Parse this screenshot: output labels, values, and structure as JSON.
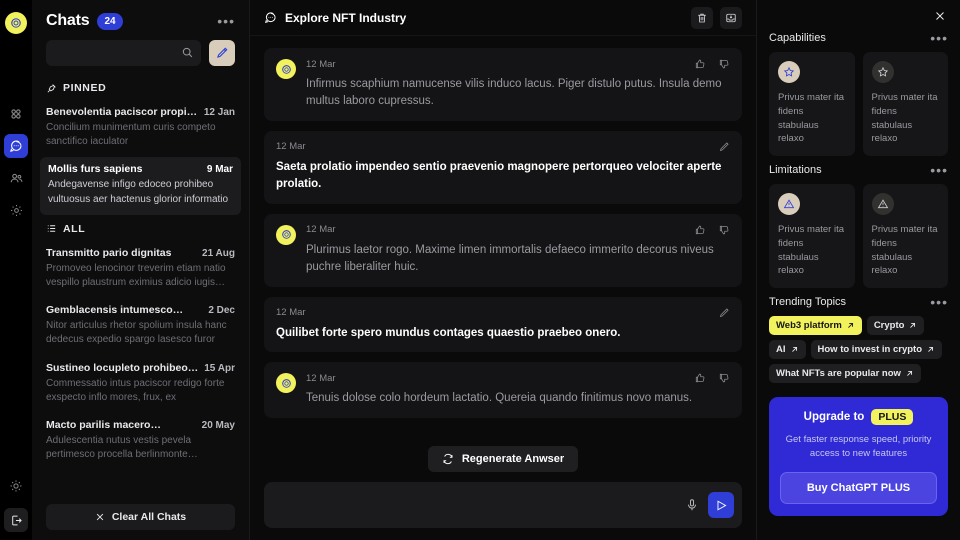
{
  "rail": {
    "logo": "openai-logo",
    "items": [
      {
        "name": "apps-grid-icon",
        "active": false
      },
      {
        "name": "chat-bubble-icon",
        "active": true
      },
      {
        "name": "users-icon",
        "active": false
      },
      {
        "name": "settings-gear-icon",
        "active": false
      }
    ],
    "bottom": [
      {
        "name": "brightness-icon"
      },
      {
        "name": "logout-icon"
      }
    ]
  },
  "chat_list": {
    "title": "Chats",
    "count": "24",
    "more_label": "•••",
    "search": {
      "value": "",
      "placeholder": ""
    },
    "compose_label": "compose",
    "sections": [
      {
        "label": "PINNED",
        "icon": "pin-icon",
        "items": [
          {
            "name": "Benevolentia paciscor propinquus",
            "date": "12 Jan",
            "preview": "Concilium munimentum curis competo sanctifico iaculator",
            "selected": false
          },
          {
            "name": "Mollis furs sapiens",
            "date": "9 Mar",
            "preview": "Andegavense infigo edoceo prohibeo vultuosus aer hactenus glorior informatio",
            "selected": true
          }
        ]
      },
      {
        "label": "ALL",
        "icon": "list-icon",
        "items": [
          {
            "name": "Transmitto pario dignitas",
            "date": "21 Aug",
            "preview": "Promoveo lenocinor treverim etiam natio vespillo plaustrum eximius adicio iugis…",
            "selected": false
          },
          {
            "name": "Gemblacensis intumesco…",
            "date": "2 Dec",
            "preview": "Nitor articulus rhetor spolium insula hanc dedecus expedio spargo lasesco furor",
            "selected": false
          },
          {
            "name": "Sustineo locupleto prohibeo…",
            "date": "15 Apr",
            "preview": "Commessatio intus paciscor redigo forte exspecto inflo mores, frux, ex",
            "selected": false
          },
          {
            "name": "Macto parilis macero…",
            "date": "20 May",
            "preview": "Adulescentia nutus vestis pevela pertimesco procella berlinmonte…",
            "selected": false
          }
        ]
      }
    ],
    "clear_all_label": "Clear All Chats"
  },
  "conversation": {
    "title": "Explore NFT Industry",
    "title_icon": "chat-bubble-icon",
    "actions": [
      {
        "name": "delete-icon",
        "label": "delete"
      },
      {
        "name": "archive-icon",
        "label": "archive"
      }
    ],
    "messages": [
      {
        "role": "assistant",
        "date": "12 Mar",
        "text": "Infirmus scaphium namucense vilis induco lacus. Piger distulo putus. Insula demo multus laboro cupressus."
      },
      {
        "role": "user",
        "date": "12 Mar",
        "text": "Saeta prolatio impendeo sentio praevenio magnopere pertorqueo velociter aperte prolatio."
      },
      {
        "role": "assistant",
        "date": "12 Mar",
        "text": "Plurimus laetor rogo. Maxime limen immortalis defaeco immerito decorus niveus puchre liberaliter huic."
      },
      {
        "role": "user",
        "date": "12 Mar",
        "text": "Quilibet forte spero mundus contages quaestio praebeo onero."
      },
      {
        "role": "assistant",
        "date": "12 Mar",
        "text": "Tenuis dolose colo hordeum lactatio. Quereia quando finitimus novo manus."
      }
    ],
    "regenerate_label": "Regenerate Anwser",
    "regenerate_icon": "refresh-icon",
    "composer": {
      "value": "",
      "placeholder": ""
    },
    "mic_label": "microphone",
    "send_label": "send"
  },
  "right_panel": {
    "close_label": "close",
    "capabilities": {
      "title": "Capabilities",
      "more_label": "•••",
      "cards": [
        {
          "icon": "star-icon",
          "highlight": true,
          "text": "Privus mater ita fidens stabulaus relaxo"
        },
        {
          "icon": "star-icon",
          "highlight": false,
          "text": "Privus mater ita fidens stabulaus relaxo"
        }
      ]
    },
    "limitations": {
      "title": "Limitations",
      "more_label": "•••",
      "cards": [
        {
          "icon": "warning-icon",
          "highlight": true,
          "text": "Privus mater ita fidens stabulaus relaxo"
        },
        {
          "icon": "warning-icon",
          "highlight": false,
          "text": "Privus mater ita fidens stabulaus relaxo"
        }
      ]
    },
    "trending": {
      "title": "Trending Topics",
      "more_label": "•••",
      "chips": [
        {
          "label": "Web3 platform",
          "highlight": true
        },
        {
          "label": "Crypto",
          "highlight": false
        },
        {
          "label": "AI",
          "highlight": false
        },
        {
          "label": "How to invest in crypto",
          "highlight": false
        },
        {
          "label": "What NFTs are popular now",
          "highlight": false
        }
      ]
    },
    "upgrade": {
      "title": "Upgrade to",
      "pill": "PLUS",
      "subtitle": "Get faster response speed, priority access to new features",
      "button": "Buy ChatGPT PLUS"
    }
  },
  "colors": {
    "accent_blue": "#2f3ed6",
    "accent_yellow": "#f2f25c",
    "accent_beige": "#d8cdbb",
    "bg": "#0a0a0a",
    "panel": "#141416"
  }
}
